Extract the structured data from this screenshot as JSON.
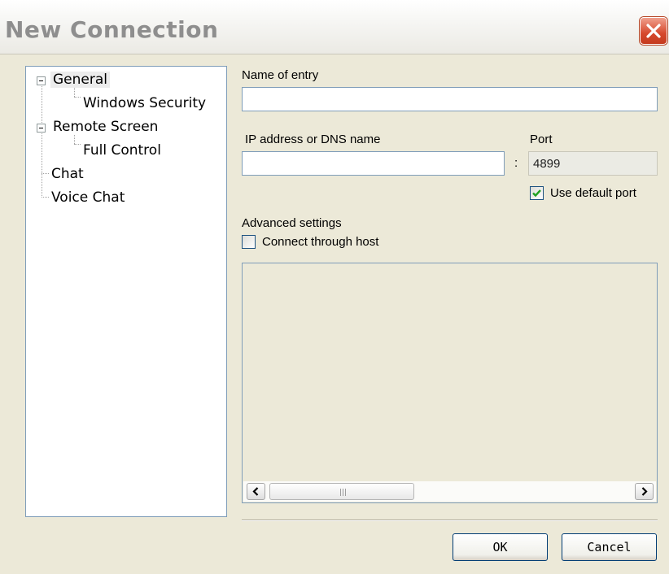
{
  "window": {
    "title": "New Connection"
  },
  "tree": {
    "items": [
      {
        "label": "General",
        "selected": true
      },
      {
        "label": "Windows Security"
      },
      {
        "label": "Remote Screen"
      },
      {
        "label": "Full Control"
      },
      {
        "label": "Chat"
      },
      {
        "label": "Voice Chat"
      }
    ]
  },
  "form": {
    "name_label": "Name of entry",
    "name_value": "",
    "ip_label": "IP address or DNS name",
    "ip_value": "",
    "separator": ":",
    "port_label": "Port",
    "port_value": "4899",
    "default_port_label": "Use default port",
    "default_port_checked": true,
    "advanced_label": "Advanced settings",
    "connect_host_label": "Connect through host",
    "connect_host_checked": false
  },
  "buttons": {
    "ok": "OK",
    "cancel": "Cancel"
  },
  "colors": {
    "field_border": "#7f9db9",
    "close_red": "#d6482c",
    "check_green": "#21a121",
    "window_bg": "#ece9d8"
  },
  "icons": {
    "close": "close-icon",
    "scroll_left": "arrow-left-icon",
    "scroll_right": "arrow-right-icon",
    "check": "checkmark-icon"
  }
}
